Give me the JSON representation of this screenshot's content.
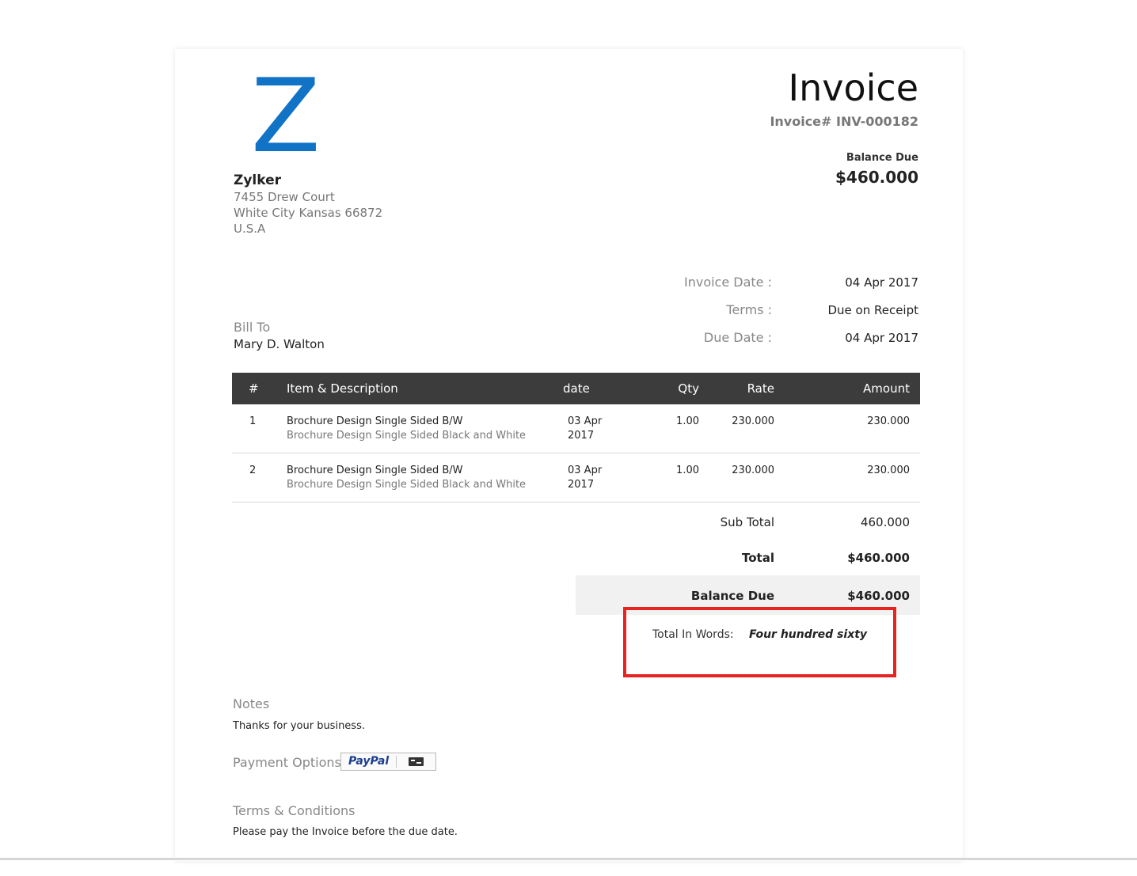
{
  "company": {
    "logo_letter": "Z",
    "name": "Zylker",
    "address_lines": [
      "7455 Drew Court",
      "White City Kansas 66872",
      "U.S.A"
    ]
  },
  "invoice": {
    "title": "Invoice",
    "number": "Invoice# INV-000182",
    "balance_due_label": "Balance Due",
    "balance_due_amount": "$460.000"
  },
  "meta": [
    {
      "label": "Invoice Date :",
      "value": "04 Apr 2017"
    },
    {
      "label": "Terms :",
      "value": "Due on Receipt"
    },
    {
      "label": "Due Date :",
      "value": "04 Apr 2017"
    }
  ],
  "bill_to": {
    "label": "Bill To",
    "name": "Mary D. Walton"
  },
  "table": {
    "headers": [
      "#",
      "Item & Description",
      "date",
      "Qty",
      "Rate",
      "Amount"
    ],
    "rows": [
      {
        "num": "1",
        "item": "Brochure Design Single Sided B/W",
        "description": "Brochure Design Single Sided Black and White",
        "date_line1": "03 Apr",
        "date_line2": "2017",
        "qty": "1.00",
        "rate": "230.000",
        "amount": "230.000"
      },
      {
        "num": "2",
        "item": "Brochure Design Single Sided B/W",
        "description": "Brochure Design Single Sided Black and White",
        "date_line1": "03 Apr",
        "date_line2": "2017",
        "qty": "1.00",
        "rate": "230.000",
        "amount": "230.000"
      }
    ]
  },
  "summary": {
    "sub_total_label": "Sub Total",
    "sub_total_value": "460.000",
    "total_label": "Total",
    "total_value": "$460.000",
    "balance_due_label": "Balance Due",
    "balance_due_value": "$460.000",
    "total_in_words_label": "Total In Words:",
    "total_in_words_value": "Four hundred sixty"
  },
  "notes": {
    "title": "Notes",
    "text": "Thanks for your business."
  },
  "payment": {
    "label": "Payment Options",
    "paypal_text": "PayPal",
    "card_icon": "credit-card-icon"
  },
  "terms": {
    "title": "Terms & Conditions",
    "text": "Please pay the Invoice before the due date."
  },
  "colors": {
    "logo": "#1173c6",
    "table_header_bg": "#3c3c3c",
    "highlight_border": "#e8231f",
    "paypal": "#1b3f8f"
  }
}
